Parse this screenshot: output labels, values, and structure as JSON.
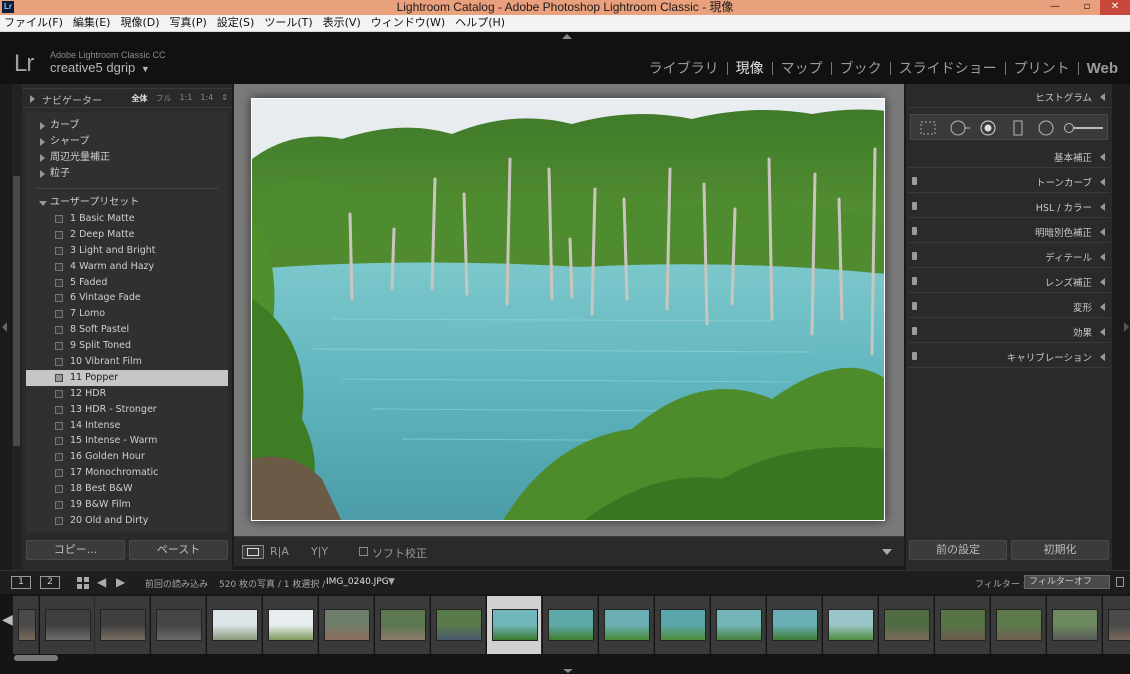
{
  "window": {
    "title": "Lightroom Catalog - Adobe Photoshop Lightroom Classic - 現像",
    "app_icon": "Lr",
    "controls": {
      "minimize": "—",
      "maximize": "▫",
      "close": "✕"
    }
  },
  "menubar": [
    "ファイル(F)",
    "編集(E)",
    "現像(D)",
    "写真(P)",
    "設定(S)",
    "ツール(T)",
    "表示(V)",
    "ウィンドウ(W)",
    "ヘルプ(H)"
  ],
  "identity": {
    "logo": "Lr",
    "product": "Adobe Lightroom Classic CC",
    "user": "creative5 dgrip",
    "user_caret": "▼"
  },
  "modules": [
    {
      "label": "ライブラリ",
      "active": false
    },
    {
      "label": "現像",
      "active": true
    },
    {
      "label": "マップ",
      "active": false
    },
    {
      "label": "ブック",
      "active": false
    },
    {
      "label": "スライドショー",
      "active": false
    },
    {
      "label": "プリント",
      "active": false
    },
    {
      "label": "Web",
      "active": false
    }
  ],
  "navigator": {
    "label": "ナビゲーター",
    "zooms": [
      "全体",
      "フル",
      "1:1",
      "1:4",
      "⇕"
    ]
  },
  "presets_panel": {
    "groups": [
      "カーブ",
      "シャープ",
      "周辺光量補正",
      "粒子"
    ],
    "user_presets_label": "ユーザープリセット",
    "items": [
      "1 Basic Matte",
      "2 Deep Matte",
      "3 Light and Bright",
      "4 Warm and Hazy",
      "5 Faded",
      "6 Vintage Fade",
      "7 Lomo",
      "8 Soft Pastel",
      "9 Split Toned",
      "10 Vibrant Film",
      "11 Popper",
      "12 HDR",
      "13 HDR - Stronger",
      "14 Intense",
      "15 Intense - Warm",
      "16 Golden Hour",
      "17 Monochromatic",
      "18 Best B&W",
      "19 B&W Film",
      "20 Old and Dirty"
    ],
    "selected_index": 10
  },
  "left_buttons": {
    "copy": "コピー...",
    "paste": "ペースト"
  },
  "toolbar": {
    "view_compare": "R|A",
    "view_before_after": "Y|Y",
    "soft_proof": "ソフト校正"
  },
  "right_panel": {
    "histogram": "ヒストグラム",
    "sections": [
      "基本補正",
      "トーンカーブ",
      "HSL / カラー",
      "明暗別色補正",
      "ディテール",
      "レンズ補正",
      "変形",
      "効果",
      "キャリブレーション"
    ],
    "prev_button": "前の設定",
    "reset_button": "初期化"
  },
  "filmstrip_bar": {
    "screen1": "1",
    "screen2": "2",
    "source": "前回の読み込み",
    "count": "520 枚の写真 / 1 枚選択 / ",
    "filename": "IMG_0240.JPG",
    "filter_label": "フィルター :",
    "filter_value": "フィルターオフ"
  },
  "colors": {
    "titlebar": "#e9a07c",
    "panel": "#2a2a2a",
    "canvas": "#7a7a7a",
    "selected": "#c6c6c6"
  }
}
